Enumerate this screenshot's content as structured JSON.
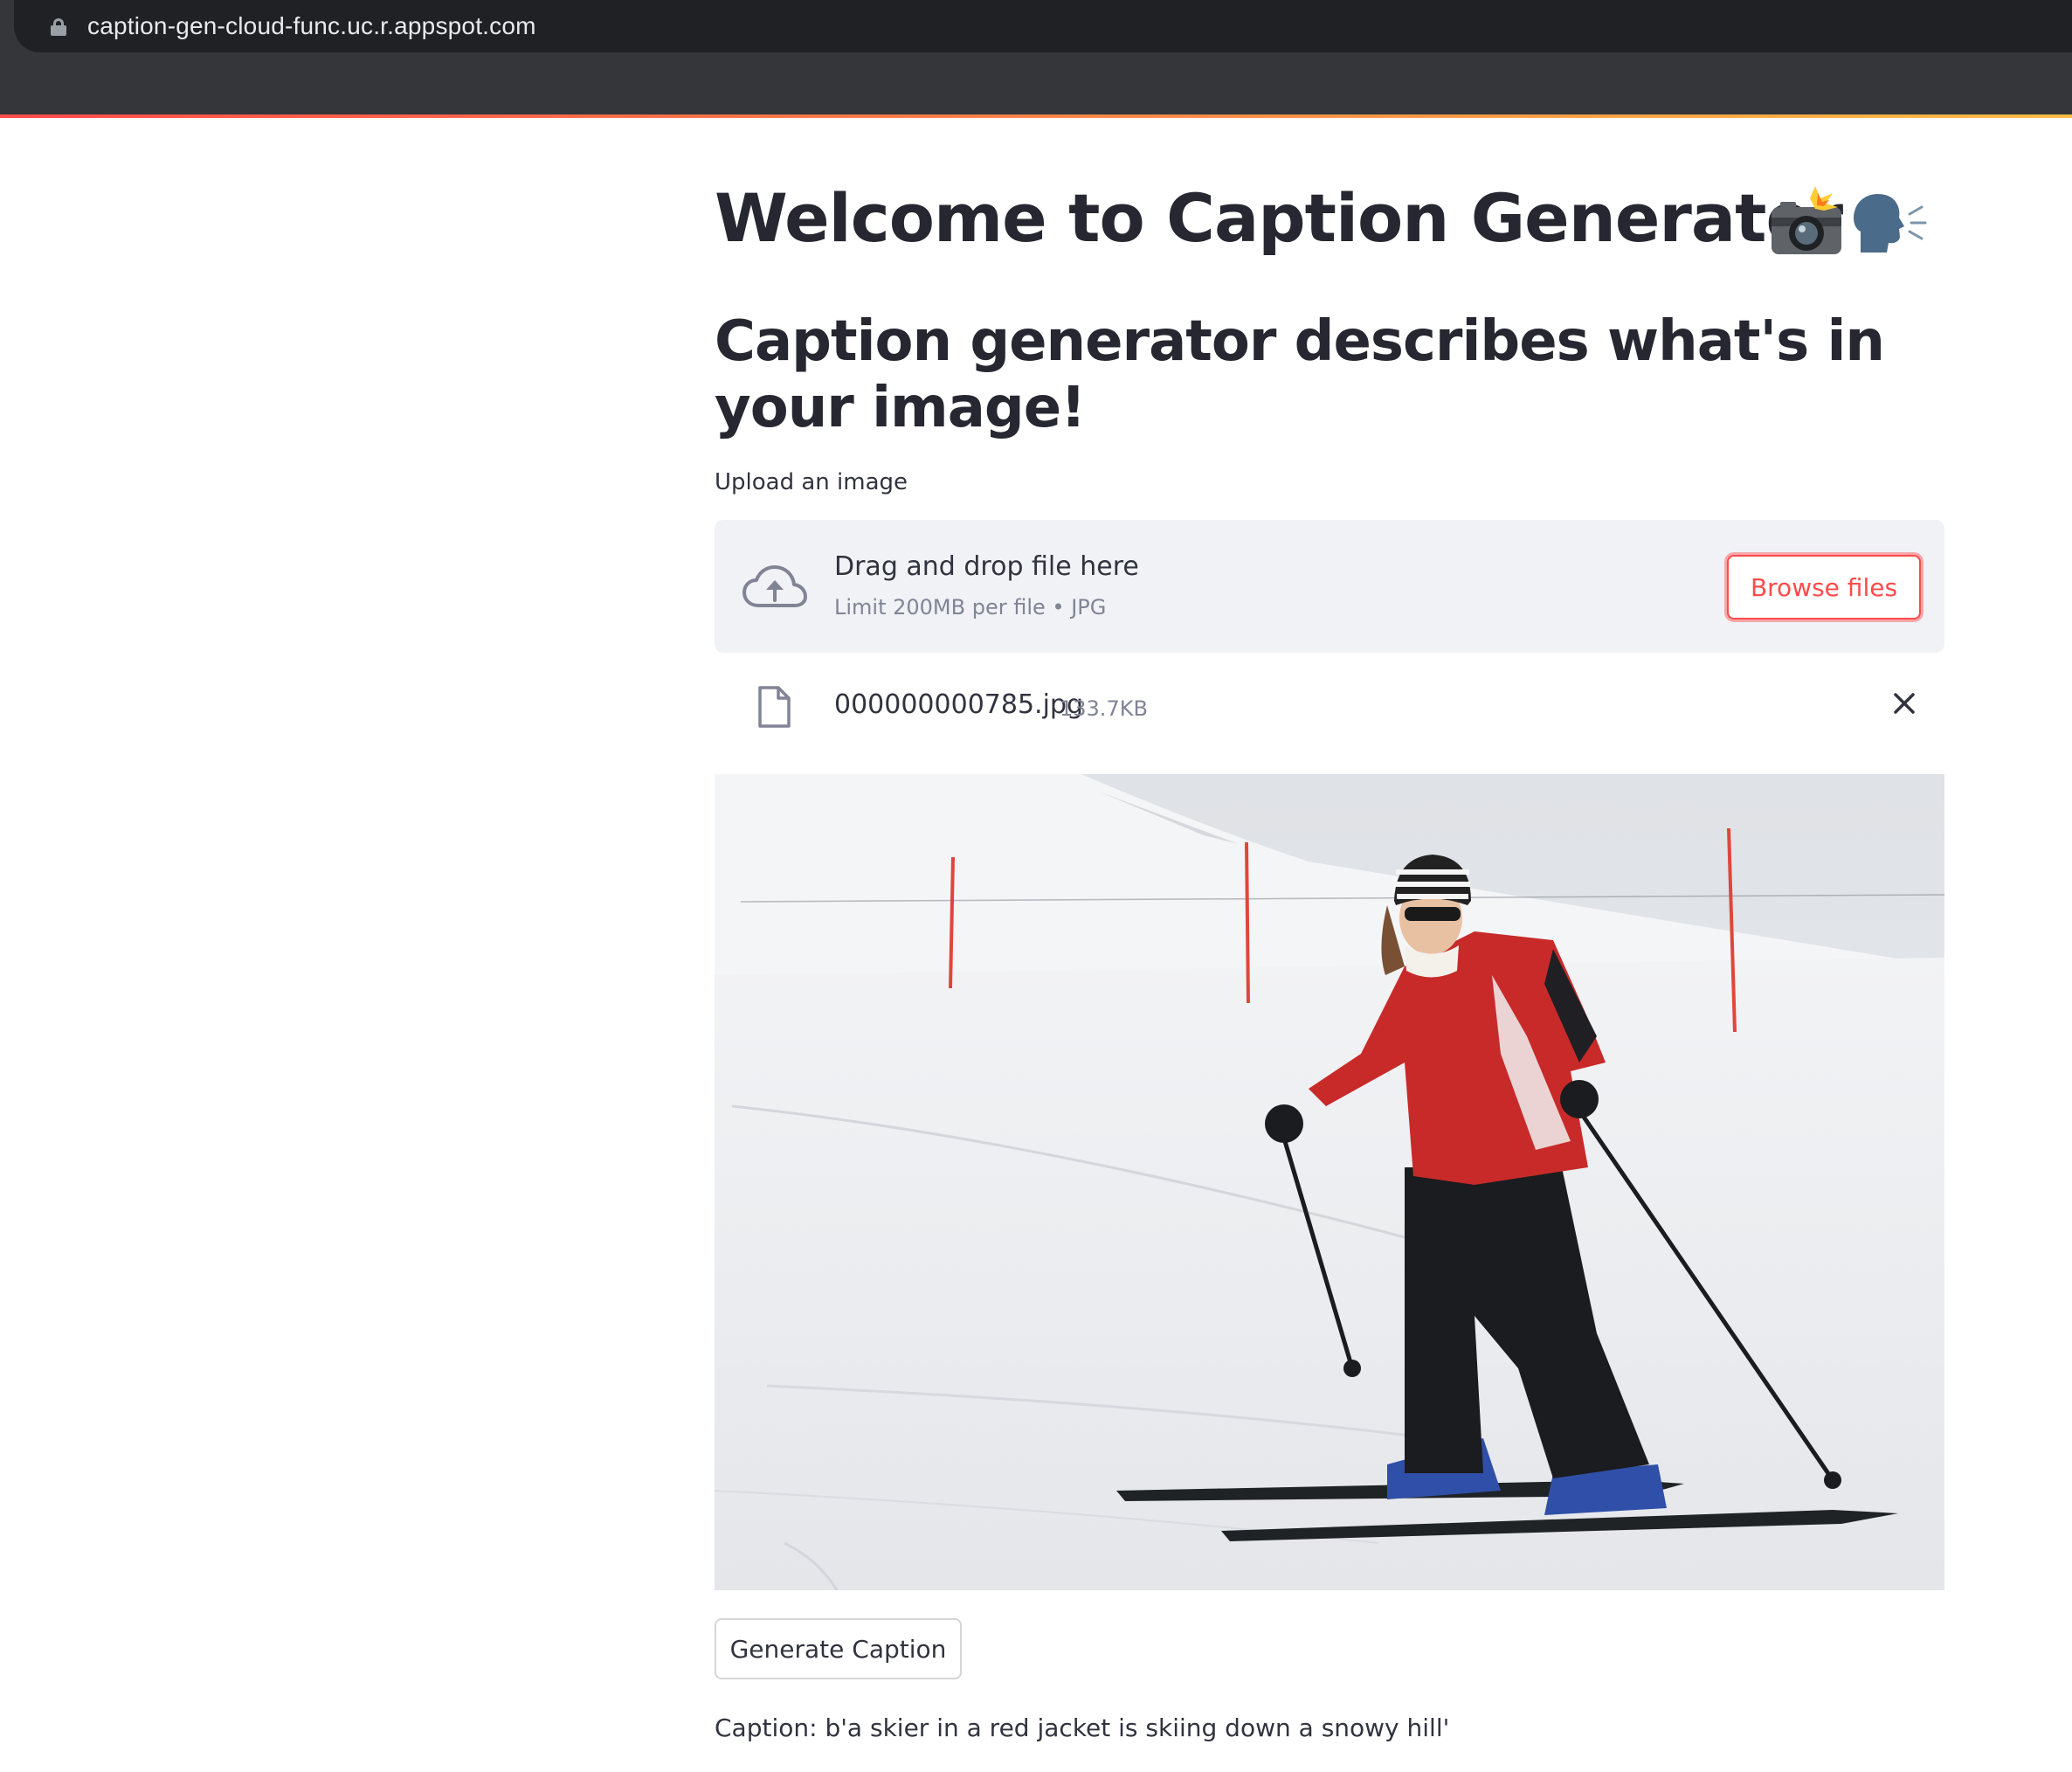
{
  "browser": {
    "url": "caption-gen-cloud-func.uc.r.appspot.com"
  },
  "page": {
    "title": "Welcome to Caption Generator",
    "subtitle": "Caption generator describes what's in your image!",
    "upload_label": "Upload an image"
  },
  "uploader": {
    "drag_drop_text": "Drag and drop file here",
    "limit_text": "Limit 200MB per file • JPG",
    "browse_label": "Browse files",
    "file": {
      "name": "000000000785.jpg",
      "size": "133.7KB"
    }
  },
  "actions": {
    "generate_label": "Generate Caption"
  },
  "result": {
    "caption": "Caption: b'a skier in a red jacket is skiing down a snowy hill'"
  },
  "colors": {
    "accent": "#ff4b4b",
    "text": "#31333f",
    "muted": "#808495",
    "dropzone_bg": "#f0f2f6"
  }
}
